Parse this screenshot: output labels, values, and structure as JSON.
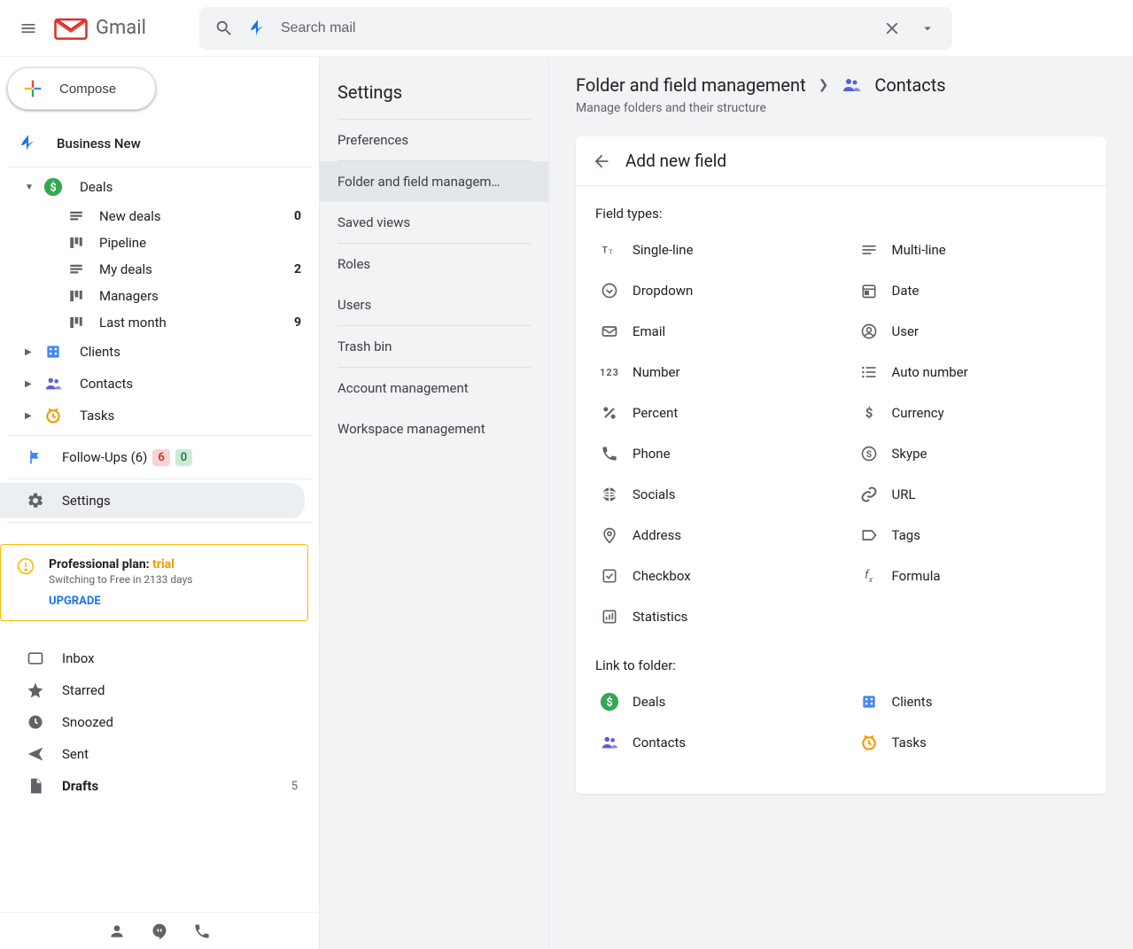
{
  "header": {
    "app_name": "Gmail",
    "search_placeholder": "Search mail"
  },
  "compose_label": "Compose",
  "workspace_name": "Business New",
  "folders": {
    "deals": {
      "label": "Deals",
      "children": [
        {
          "label": "New deals",
          "count": "0"
        },
        {
          "label": "Pipeline",
          "count": ""
        },
        {
          "label": "My deals",
          "count": "2"
        },
        {
          "label": "Managers",
          "count": ""
        },
        {
          "label": "Last month",
          "count": "9"
        }
      ]
    },
    "clients": {
      "label": "Clients"
    },
    "contacts": {
      "label": "Contacts"
    },
    "tasks": {
      "label": "Tasks"
    }
  },
  "followups": {
    "label": "Follow-Ups (6)",
    "badge_red": "6",
    "badge_green": "0"
  },
  "settings_label": "Settings",
  "plan": {
    "title_prefix": "Professional plan: ",
    "title_trial": "trial",
    "subtitle": "Switching to Free in 2133 days",
    "upgrade": "UPGRADE"
  },
  "gmail_nav": [
    {
      "label": "Inbox",
      "count": ""
    },
    {
      "label": "Starred",
      "count": ""
    },
    {
      "label": "Snoozed",
      "count": ""
    },
    {
      "label": "Sent",
      "count": ""
    },
    {
      "label": "Drafts",
      "count": "5"
    }
  ],
  "settings_panel": {
    "title": "Settings",
    "items": {
      "preferences": "Preferences",
      "folder_mgmt": "Folder and field managem…",
      "saved_views": "Saved views",
      "roles": "Roles",
      "users": "Users",
      "trash": "Trash bin",
      "account": "Account management",
      "workspace": "Workspace management"
    }
  },
  "main": {
    "breadcrumb_root": "Folder and field management",
    "breadcrumb_leaf": "Contacts",
    "breadcrumb_sub": "Manage folders and their structure",
    "card_title": "Add new field",
    "field_types_label": "Field types:",
    "field_types": [
      {
        "id": "single-line",
        "label": "Single-line"
      },
      {
        "id": "multi-line",
        "label": "Multi-line"
      },
      {
        "id": "dropdown",
        "label": "Dropdown"
      },
      {
        "id": "date",
        "label": "Date"
      },
      {
        "id": "email",
        "label": "Email"
      },
      {
        "id": "user",
        "label": "User"
      },
      {
        "id": "number",
        "label": "Number"
      },
      {
        "id": "auto-number",
        "label": "Auto number"
      },
      {
        "id": "percent",
        "label": "Percent"
      },
      {
        "id": "currency",
        "label": "Currency"
      },
      {
        "id": "phone",
        "label": "Phone"
      },
      {
        "id": "skype",
        "label": "Skype"
      },
      {
        "id": "socials",
        "label": "Socials"
      },
      {
        "id": "url",
        "label": "URL"
      },
      {
        "id": "address",
        "label": "Address"
      },
      {
        "id": "tags",
        "label": "Tags"
      },
      {
        "id": "checkbox",
        "label": "Checkbox"
      },
      {
        "id": "formula",
        "label": "Formula"
      },
      {
        "id": "statistics",
        "label": "Statistics"
      }
    ],
    "link_label": "Link to folder:",
    "link_folders": [
      {
        "id": "deals",
        "label": "Deals"
      },
      {
        "id": "clients",
        "label": "Clients"
      },
      {
        "id": "contacts",
        "label": "Contacts"
      },
      {
        "id": "tasks",
        "label": "Tasks"
      }
    ]
  }
}
